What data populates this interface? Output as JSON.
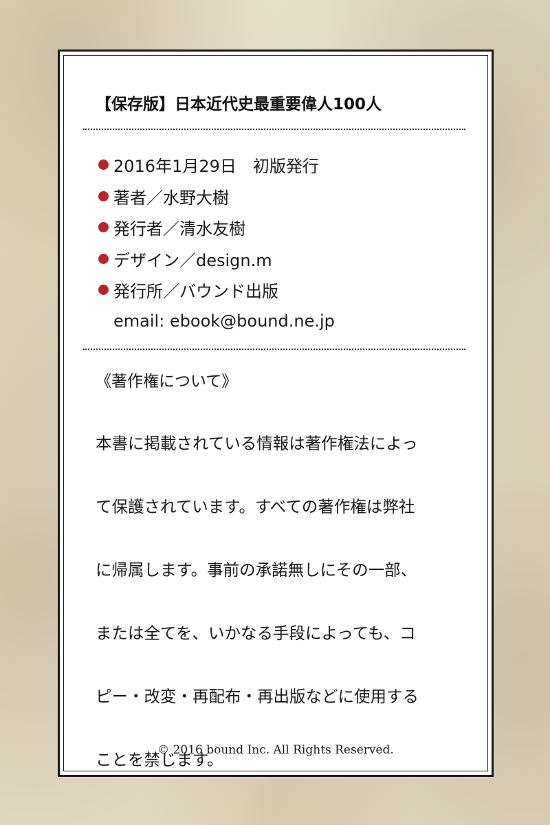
{
  "title": "【保存版】日本近代史最重要偉人100人",
  "info": {
    "items": [
      {
        "text": "2016年1月29日　初版発行",
        "bullet": true
      },
      {
        "text": "著者／水野大樹",
        "bullet": true
      },
      {
        "text": "発行者／清水友樹",
        "bullet": true
      },
      {
        "text": "デザイン／design.m",
        "bullet": true
      },
      {
        "text": "発行所／バウンド出版",
        "bullet": true
      },
      {
        "text": "email: ebook@bound.ne.jp",
        "bullet": false
      }
    ]
  },
  "copyright": {
    "heading": "《著作権について》",
    "lines": [
      "本書に掲載されている情報は著作権法によっ",
      "て保護されています。すべての著作権は弊社",
      "に帰属します。事前の承諾無しにその一部、",
      "または全てを、いかなる手段によっても、コ",
      "ピー・改変・再配布・再出版などに使用する",
      "ことを禁じます。"
    ]
  },
  "footer": "© 2016 bound Inc. All Rights Reserved.",
  "colors": {
    "background": "#e6dcc6",
    "card": "#ffffff",
    "bullet": "#b3262b",
    "text": "#1a1a1a"
  }
}
